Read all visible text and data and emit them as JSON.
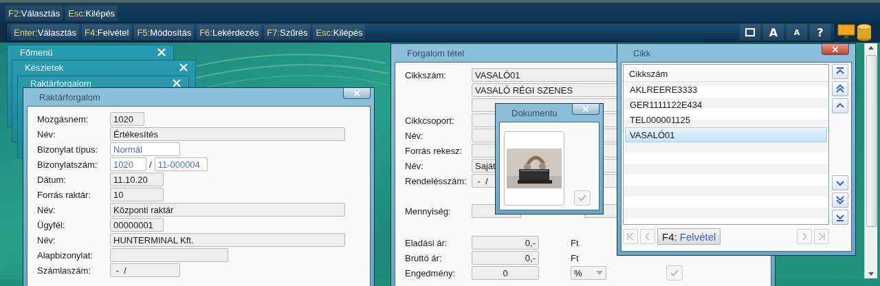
{
  "top_bar": {
    "hints": [
      {
        "key": "F2:",
        "action": "Választás"
      },
      {
        "key": "Esc:",
        "action": "Kilépés"
      }
    ]
  },
  "toolbar": {
    "hints": [
      {
        "key": "Enter:",
        "action": "Választás"
      },
      {
        "key": "F4:",
        "action": "Felvétel"
      },
      {
        "key": "F5:",
        "action": "Módosítás"
      },
      {
        "key": "F6:",
        "action": "Lekérdezés"
      },
      {
        "key": "F7:",
        "action": "Szűrés"
      },
      {
        "key": "Esc:",
        "action": "Kilépés"
      }
    ],
    "tools": [
      {
        "kind": "window"
      },
      {
        "kind": "text",
        "label": "A"
      },
      {
        "kind": "small-text",
        "label": "A"
      },
      {
        "kind": "text",
        "label": "?"
      }
    ]
  },
  "background_windows": [
    {
      "title": "Főmenü"
    },
    {
      "title": "Készletek"
    },
    {
      "title": "Raktárforgalom"
    }
  ],
  "raktarforgalom": {
    "title": "Raktárforgalom",
    "fields": [
      {
        "label": "Mozgásnem:",
        "values": [
          "1020"
        ],
        "kind": "readonly"
      },
      {
        "label": "Név:",
        "values": [
          "Értékesítés"
        ],
        "kind": "readonly"
      },
      {
        "label": "Bizonylat típus:",
        "values": [
          "Normál"
        ],
        "kind": "editable"
      },
      {
        "label": "Bizonylatszám:",
        "values": [
          "1020",
          "11-000004"
        ],
        "separator": "/",
        "kind": "editable"
      },
      {
        "label": "Dátum:",
        "values": [
          "11.10.20"
        ],
        "kind": "readonly"
      },
      {
        "label": "Forrás raktár:",
        "values": [
          "10"
        ],
        "kind": "readonly"
      },
      {
        "label": "Név:",
        "values": [
          "Központi raktár"
        ],
        "kind": "readonly"
      },
      {
        "label": "Ügyfél:",
        "values": [
          "00000001"
        ],
        "kind": "readonly"
      },
      {
        "label": "Név:",
        "values": [
          "HUNTERMINAL Kft."
        ],
        "kind": "readonly"
      },
      {
        "label": "Alapbizonylat:",
        "kind": "empty"
      },
      {
        "label": "Számlaszám:",
        "values": [
          " -  /"
        ],
        "kind": "readonly"
      }
    ]
  },
  "forgalom_tetel": {
    "title": "Forgalom tétel",
    "fields": [
      {
        "kind": "filled",
        "label": "Cikkszám:",
        "value": "VASALÓ01"
      },
      {
        "kind": "filled",
        "value": "VASALÓ RÉGI SZENES"
      },
      {
        "kind": "empty"
      },
      {
        "kind": "empty",
        "label": "Cikkcsoport:"
      },
      {
        "kind": "empty",
        "label": "Név:"
      },
      {
        "kind": "empty",
        "label": "Forrás rekesz:"
      },
      {
        "kind": "filled",
        "label": "Név:",
        "value": "Saját"
      },
      {
        "kind": "filled",
        "label": "Rendelésszám:",
        "value": " -  /"
      }
    ],
    "quantity": {
      "label": "Mennyiség:"
    },
    "prices": [
      {
        "label": "Eladási ár:",
        "value": "0,-",
        "unit": "Ft"
      },
      {
        "label": "Bruttó ár:",
        "value": "0,-",
        "unit": "Ft"
      }
    ],
    "discount": {
      "label": "Engedmény:",
      "value": "0",
      "unit": "%"
    }
  },
  "dokumentum": {
    "title": "Dokumentu",
    "kind": "picture"
  },
  "cikk": {
    "title": "Cikk",
    "column": "Cikkszám",
    "rows": [
      {
        "code": "AKLREERE3333",
        "selected": false
      },
      {
        "code": "GER1111122E434",
        "selected": false
      },
      {
        "code": "TEL000001125",
        "selected": false
      },
      {
        "code": "VASALÓ01",
        "selected": true
      }
    ],
    "add_button": {
      "key": "F4:",
      "action": "Felvétel"
    }
  }
}
